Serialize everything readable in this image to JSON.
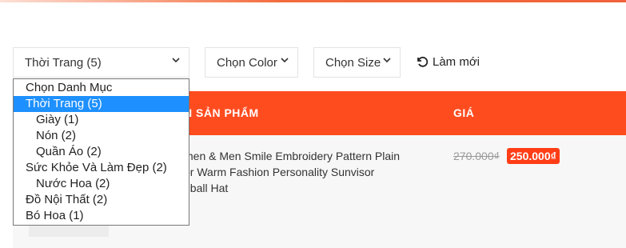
{
  "filters": {
    "category_value": "Thời Trang  (5)",
    "color_label": "Chọn Color",
    "size_label": "Chọn Size",
    "refresh_label": "Làm mới"
  },
  "dropdown": {
    "options": [
      {
        "label": "Chọn Danh Mục",
        "level": 0,
        "selected": false
      },
      {
        "label": "Thời Trang  (5)",
        "level": 0,
        "selected": true
      },
      {
        "label": "Giày  (1)",
        "level": 1,
        "selected": false
      },
      {
        "label": "Nón  (2)",
        "level": 1,
        "selected": false
      },
      {
        "label": "Quần Áo  (2)",
        "level": 1,
        "selected": false
      },
      {
        "label": "Sức Khỏe Và Làm Đẹp  (2)",
        "level": 0,
        "selected": false
      },
      {
        "label": "Nước Hoa  (2)",
        "level": 1,
        "selected": false
      },
      {
        "label": "Đồ Nội Thất  (2)",
        "level": 0,
        "selected": false
      },
      {
        "label": "Bó Hoa  (1)",
        "level": 0,
        "selected": false
      }
    ]
  },
  "table": {
    "header_name": "N SẢN PHẨM",
    "header_price": "GIÁ",
    "product": {
      "name": "men & Men Smile Embroidery Pattern Plain\nor Warm Fashion Personality Sunvisor\neball Hat",
      "old_price": "270.000₫",
      "new_price": "250.000₫"
    }
  },
  "colors": {
    "accent": "#ff4c1f",
    "price_badge": "#ff3d16",
    "selected_option": "#1e90ff"
  }
}
